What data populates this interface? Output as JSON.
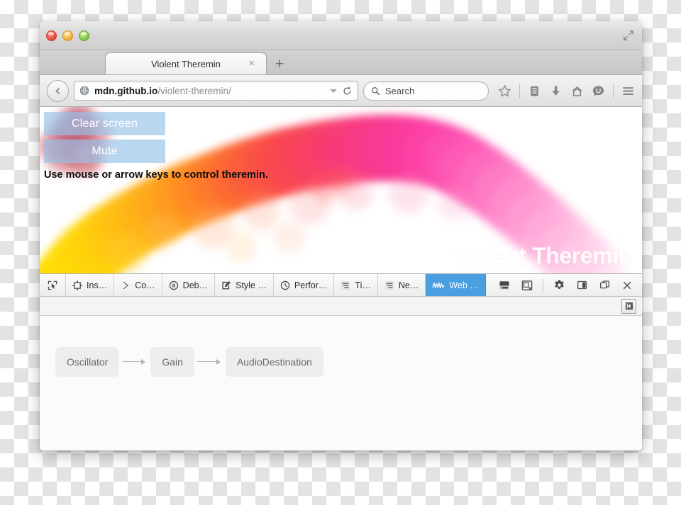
{
  "window": {
    "traffic_lights": [
      "close",
      "minimize",
      "zoom"
    ],
    "expand_icon": "fullscreen-expand-icon"
  },
  "tabbar": {
    "tab_title": "Violent Theremin",
    "close_label": "×",
    "newtab_label": "+"
  },
  "navbar": {
    "back_icon": "back-arrow-icon",
    "site_icon": "globe-icon",
    "url_host": "mdn.github.io",
    "url_path": "/violent-theremin/",
    "reload_icon": "reload-icon",
    "search_placeholder": "Search",
    "search_icon": "search-icon",
    "icons": [
      {
        "name": "bookmark-star-icon"
      },
      {
        "name": "reader-list-icon"
      },
      {
        "name": "downloads-icon"
      },
      {
        "name": "home-icon"
      },
      {
        "name": "sync-smiley-icon"
      },
      {
        "name": "hamburger-menu-icon"
      }
    ]
  },
  "page": {
    "clear_button": "Clear screen",
    "mute_button": "Mute",
    "hint": "Use mouse or arrow keys to control theremin.",
    "watermark": "Violent Theremin",
    "accent_colors": {
      "yellow": "#ffde00",
      "orange": "#ff9a1e",
      "red": "#fb4a5e",
      "pink": "#ff3d9e",
      "light_pink": "#ffa8d6",
      "button_bg": "#96c3e8"
    }
  },
  "devtools": {
    "picker_icon": "element-picker-icon",
    "tabs": [
      {
        "label": "Ins…",
        "icon": "inspector-icon",
        "active": false
      },
      {
        "label": "Co…",
        "icon": "console-chevron-icon",
        "active": false
      },
      {
        "label": "Deb…",
        "icon": "debugger-pause-icon",
        "active": false
      },
      {
        "label": "Style …",
        "icon": "style-editor-icon",
        "active": false
      },
      {
        "label": "Perfor…",
        "icon": "performance-stopwatch-icon",
        "active": false
      },
      {
        "label": "Ti…",
        "icon": "timeline-bars-icon",
        "active": false
      },
      {
        "label": "Ne…",
        "icon": "network-bars-icon",
        "active": false
      },
      {
        "label": "Web …",
        "icon": "web-audio-waveform-icon",
        "active": true
      }
    ],
    "right_buttons": [
      {
        "name": "split-console-button",
        "icon": "split-console-icon"
      },
      {
        "name": "responsive-design-button",
        "icon": "responsive-design-icon"
      },
      {
        "name": "settings-button",
        "icon": "gear-icon"
      },
      {
        "name": "dock-side-button",
        "icon": "dock-side-icon"
      },
      {
        "name": "separate-window-button",
        "icon": "separate-window-icon"
      },
      {
        "name": "close-devtools-button",
        "icon": "close-icon"
      }
    ],
    "sidebar_toggle_icon": "sidebar-toggle-icon",
    "accent": "#4a9fe0",
    "audio_graph": {
      "nodes": [
        "Oscillator",
        "Gain",
        "AudioDestination"
      ]
    }
  }
}
